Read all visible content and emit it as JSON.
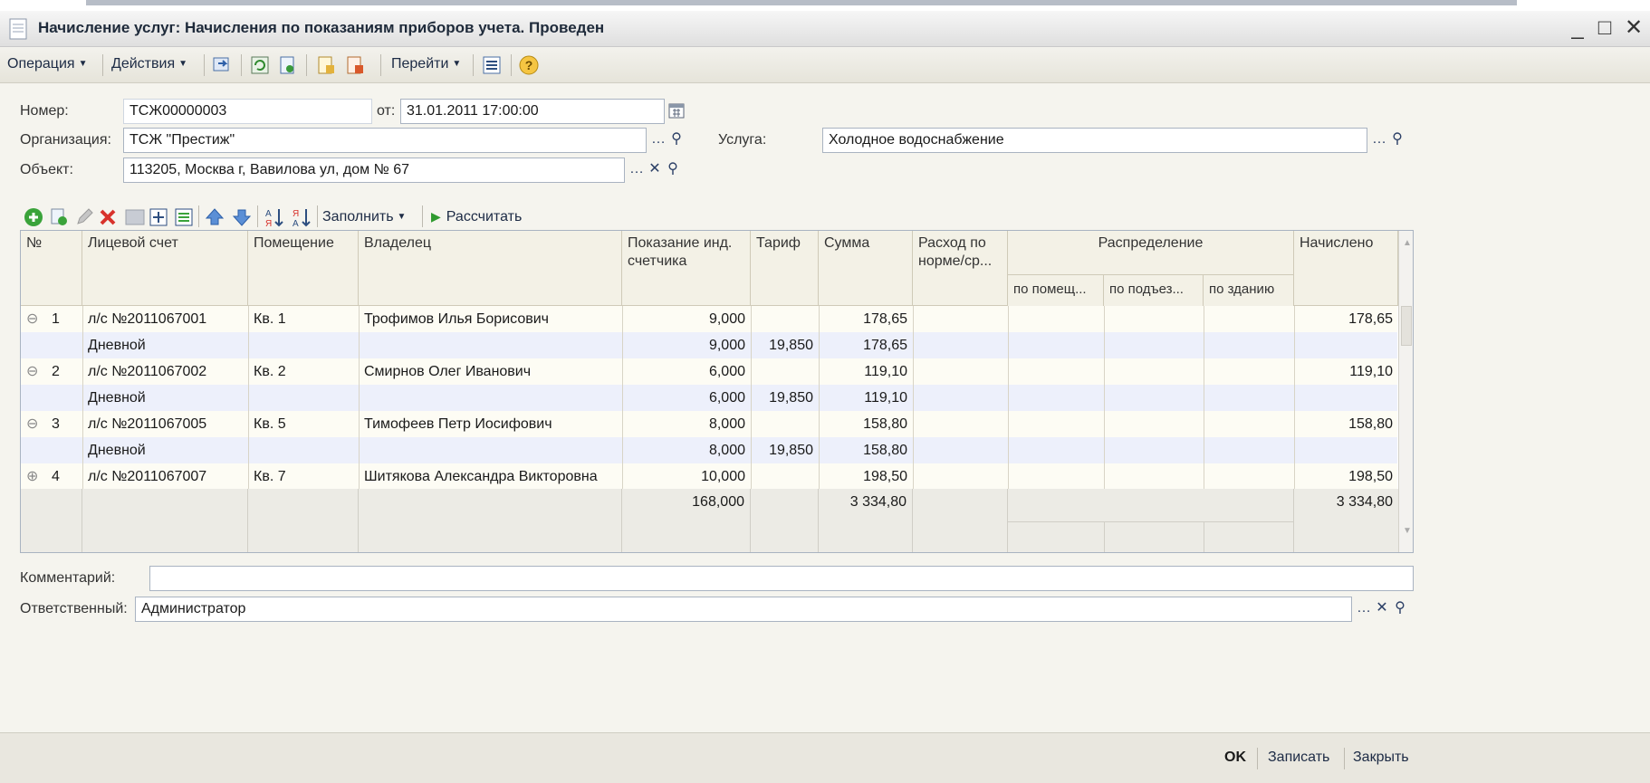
{
  "window": {
    "title": "Начисление услуг: Начисления по показаниям приборов учета. Проведен",
    "minimize": "_",
    "maximize": "□",
    "close": "✕"
  },
  "commandbar": {
    "operation": "Операция",
    "actions": "Действия",
    "goto": "Перейти"
  },
  "form": {
    "number_label": "Номер:",
    "number_value": "ТСЖ00000003",
    "date_label": "от:",
    "date_value": "31.01.2011 17:00:00",
    "org_label": "Организация:",
    "org_value": "ТСЖ \"Престиж\"",
    "service_label": "Услуга:",
    "service_value": "Холодное водоснабжение",
    "object_label": "Объект:",
    "object_value": "113205, Москва г, Вавилова ул, дом № 67"
  },
  "table_toolbar": {
    "fill": "Заполнить",
    "calculate": "Рассчитать"
  },
  "grid": {
    "headers": {
      "num": "№",
      "account": "Лицевой счет",
      "room": "Помещение",
      "owner": "Владелец",
      "reading": "Показание инд. счетчика",
      "tariff": "Тариф",
      "sum": "Сумма",
      "norm": "Расход по норме/ср...",
      "distribution": "Распределение",
      "by_room": "по помещ...",
      "by_entrance": "по подъез...",
      "by_building": "по зданию",
      "charged": "Начислено"
    },
    "rows": [
      {
        "toggle": "⊖",
        "num": "1",
        "account": "л/с №2011067001",
        "room": "Кв. 1",
        "owner": "Трофимов Илья Борисович",
        "reading": "9,000",
        "tariff": "",
        "sum": "178,65",
        "charged": "178,65"
      },
      {
        "toggle": "",
        "num": "",
        "account": "Дневной",
        "room": "",
        "owner": "",
        "reading": "9,000",
        "tariff": "19,850",
        "sum": "178,65",
        "charged": ""
      },
      {
        "toggle": "⊖",
        "num": "2",
        "account": "л/с №2011067002",
        "room": "Кв. 2",
        "owner": "Смирнов Олег Иванович",
        "reading": "6,000",
        "tariff": "",
        "sum": "119,10",
        "charged": "119,10"
      },
      {
        "toggle": "",
        "num": "",
        "account": "Дневной",
        "room": "",
        "owner": "",
        "reading": "6,000",
        "tariff": "19,850",
        "sum": "119,10",
        "charged": ""
      },
      {
        "toggle": "⊖",
        "num": "3",
        "account": "л/с №2011067005",
        "room": "Кв. 5",
        "owner": "Тимофеев Петр Иосифович",
        "reading": "8,000",
        "tariff": "",
        "sum": "158,80",
        "charged": "158,80"
      },
      {
        "toggle": "",
        "num": "",
        "account": "Дневной",
        "room": "",
        "owner": "",
        "reading": "8,000",
        "tariff": "19,850",
        "sum": "158,80",
        "charged": ""
      },
      {
        "toggle": "⊕",
        "num": "4",
        "account": "л/с №2011067007",
        "room": "Кв. 7",
        "owner": "Шитякова Александра Викторовна",
        "reading": "10,000",
        "tariff": "",
        "sum": "198,50",
        "charged": "198,50"
      }
    ],
    "totals": {
      "reading": "168,000",
      "sum": "3 334,80",
      "charged": "3 334,80"
    }
  },
  "bottom": {
    "comment_label": "Комментарий:",
    "comment_value": "",
    "responsible_label": "Ответственный:",
    "responsible_value": "Администратор"
  },
  "footer": {
    "ok": "OK",
    "save": "Записать",
    "close": "Закрыть"
  },
  "colors": {
    "window_bg": "#f5f4ee",
    "header_bg": "#f3f1e6",
    "row_alt": "#edf0fb",
    "row_main": "#fdfcf4",
    "distribution_bg": "#efe8f7",
    "add_green": "#3aa33a",
    "delete_red": "#d8322b"
  }
}
